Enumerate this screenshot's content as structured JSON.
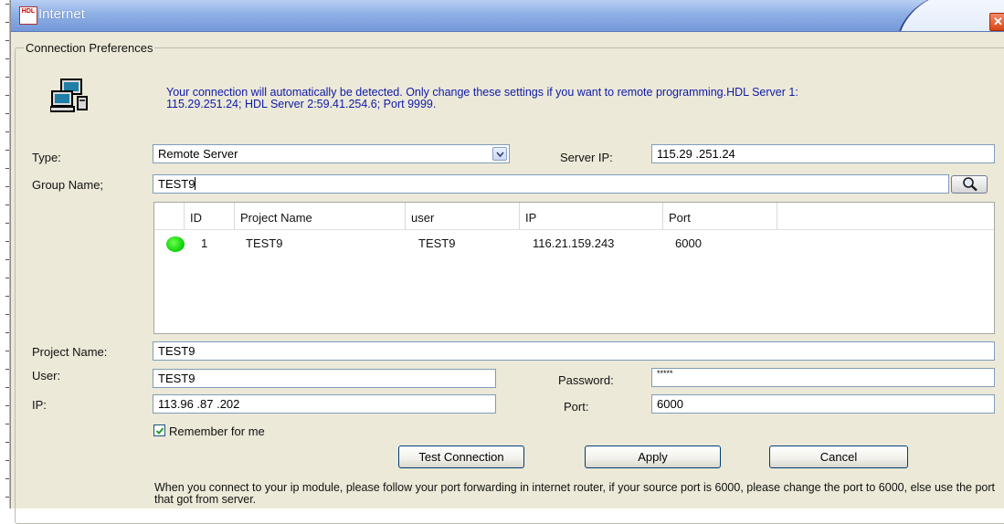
{
  "window": {
    "title": "Internet",
    "logo_text": "HDL"
  },
  "group": {
    "title": "Connection Preferences"
  },
  "info_text": "Your connection will automatically be detected. Only change these settings if you want to remote programming.HDL Server 1: 115.29.251.24; HDL Server 2:59.41.254.6; Port 9999.",
  "type": {
    "label": "Type:",
    "value": "Remote Server"
  },
  "server_ip": {
    "label": "Server IP:",
    "value": "115.29 .251.24"
  },
  "group_name": {
    "label": "Group Name;",
    "value": "TEST9"
  },
  "table": {
    "headers": [
      "",
      "ID",
      "Project Name",
      "user",
      "IP",
      "Port",
      ""
    ],
    "rows": [
      {
        "status": "online",
        "id": "1",
        "project_name": "TEST9",
        "user": "TEST9",
        "ip": "116.21.159.243",
        "port": "6000"
      }
    ]
  },
  "project_name": {
    "label": "Project Name:",
    "value": "TEST9"
  },
  "user": {
    "label": "User:",
    "value": "TEST9"
  },
  "password": {
    "label": "Password:",
    "value": "*****"
  },
  "ip": {
    "label": "IP:",
    "value": "113.96 .87 .202"
  },
  "port": {
    "label": "Port:",
    "value": "6000"
  },
  "remember": {
    "label": "Remember for me",
    "checked": true
  },
  "buttons": {
    "test": "Test Connection",
    "apply": "Apply",
    "cancel": "Cancel"
  },
  "note": "When you connect to your ip module, please follow your port forwarding in internet router, if your source port is 6000, please change the port to 6000, else use the port that got from server.",
  "icons": {
    "computer": "computer-network-icon",
    "search": "magnifier-icon",
    "dropdown": "chevron-down-icon",
    "close": "close-icon",
    "status": "green-status-icon"
  },
  "colors": {
    "titlebar": "#8fb0e6",
    "info_text": "#0f1aa8",
    "window_bg": "#ece9d8",
    "close": "#d84616",
    "status_online": "#16d60f"
  }
}
